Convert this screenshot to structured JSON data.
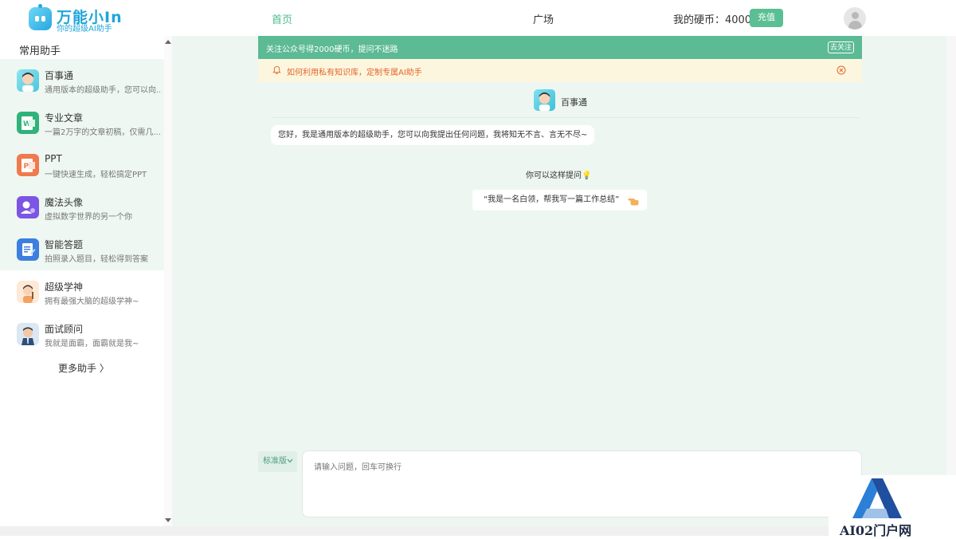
{
  "header": {
    "logo_title": "万能小In",
    "logo_subtitle": "你的超级AI助手",
    "nav_home": "首页",
    "nav_plaza": "广场",
    "coins_text": "我的硬币：4000",
    "recharge_label": "充值"
  },
  "sidebar": {
    "heading": "常用助手",
    "items": [
      {
        "title": "百事通",
        "desc": "通用版本的超级助手，您可以向...",
        "icon": "boy-avatar-icon",
        "color": "#6fd3e8"
      },
      {
        "title": "专业文章",
        "desc": "一篇2万字的文章初稿，仅需几...",
        "icon": "word-document-icon",
        "color": "#2fb37a"
      },
      {
        "title": "PPT",
        "desc": "一键快速生成，轻松搞定PPT",
        "icon": "ppt-icon",
        "color": "#f07a4d"
      },
      {
        "title": "魔法头像",
        "desc": "虚拟数字世界的另一个你",
        "icon": "magic-avatar-icon",
        "color": "#7b55e3"
      },
      {
        "title": "智能答题",
        "desc": "拍照录入题目，轻松得到答案",
        "icon": "answer-sheet-icon",
        "color": "#3c7fe0"
      },
      {
        "title": "超级学神",
        "desc": "拥有最强大脑的超级学神~",
        "icon": "teacher-avatar-icon",
        "color": "#f4a261"
      },
      {
        "title": "面试顾问",
        "desc": "我就是面霸，面霸就是我~",
        "icon": "interviewer-avatar-icon",
        "color": "#5b7fa8"
      }
    ],
    "more_label": "更多助手 〉"
  },
  "main": {
    "green_banner": "关注公众号得2000硬币，提问不迷路",
    "unfollow_label": "去关注",
    "yellow_banner": "如何利用私有知识库，定制专属AI助手",
    "bot_name": "百事通",
    "greeting": "您好，我是通用版本的超级助手，您可以向我提出任何问题，我将知无不言、言无不尽~",
    "suggest_title": "你可以这样提问💡",
    "suggestion": "“我是一名白领，帮我写一篇工作总结”",
    "mode_label": "标准版",
    "input_placeholder": "请输入问题，回车可换行"
  },
  "watermark": {
    "text": "AI02门户网"
  },
  "colors": {
    "accent": "#5bbf94",
    "banner_green": "#5cba95",
    "banner_yellow": "#fdf6df",
    "warning_text": "#e2662d",
    "main_bg": "#eef6f2"
  }
}
